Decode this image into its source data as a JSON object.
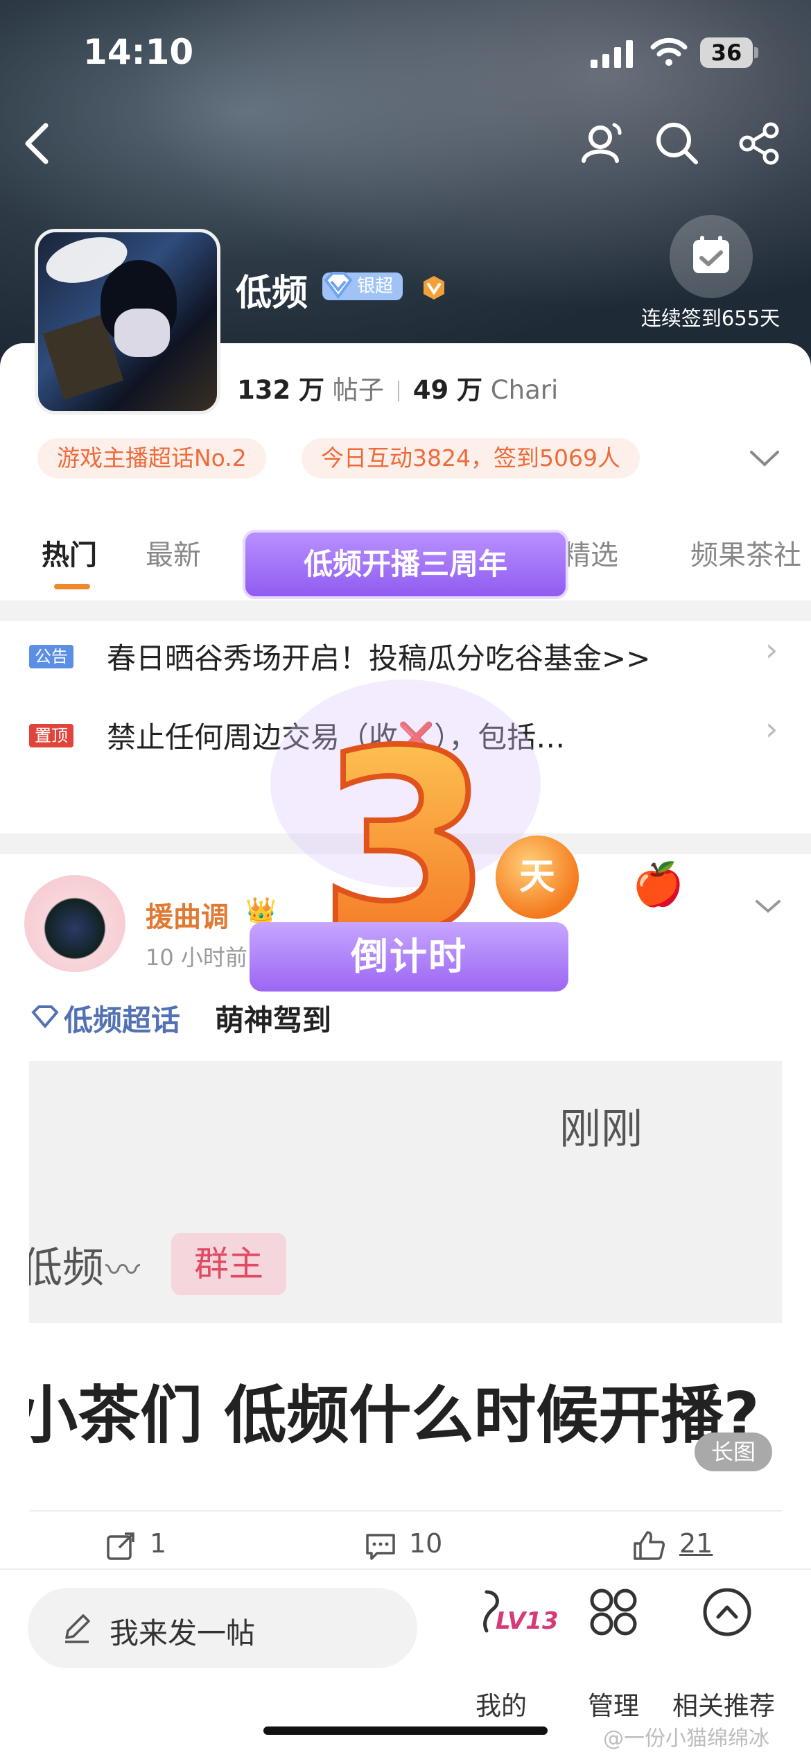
{
  "status_bar": {
    "time": "14:10",
    "battery": "36"
  },
  "header": {
    "title": "低频",
    "tier_label": "银超",
    "checkin_label": "连续签到655天",
    "stats": {
      "posts_num": "132",
      "posts_unit": "万",
      "posts_label": "帖子",
      "fans_num": "49",
      "fans_unit": "万",
      "fans_label": "Chari"
    }
  },
  "tags": [
    "游戏主播超话No.2",
    "今日互动3824，签到5069人"
  ],
  "tabs": [
    "热门",
    "最新",
    "精选",
    "频果茶社"
  ],
  "banner": {
    "text": "低频开播三周年"
  },
  "notices": [
    {
      "badge": "公告",
      "text": "春日晒谷秀场开启！投稿瓜分吃谷基金>>",
      "badge_color": "#5b8fe6"
    },
    {
      "badge": "置顶",
      "text": "禁止任何周边交易（收❌），包括…",
      "badge_color": "#e0453c"
    }
  ],
  "post": {
    "author": "援曲调",
    "time": "10 小时前",
    "topic": "低频超话",
    "text": "萌神驾到",
    "image": {
      "line1": "刚刚",
      "line2": "低频",
      "tag": "群主",
      "line3": "小茶们 低频什么时候开播?",
      "badge": "长图"
    },
    "actions": {
      "share": "1",
      "comment": "10",
      "like": "21"
    }
  },
  "countdown": {
    "number": "3",
    "unit": "天",
    "label": "倒计时"
  },
  "bottom_bar": {
    "compose": "我来发一帖",
    "level": "LV13",
    "items": [
      "我的",
      "管理",
      "相关推荐"
    ]
  },
  "watermark": "@一份小猫绵绵冰",
  "colors": {
    "accent": "#f0882e",
    "purple": "#9b66f3",
    "tag_text": "#ee6a3a"
  }
}
